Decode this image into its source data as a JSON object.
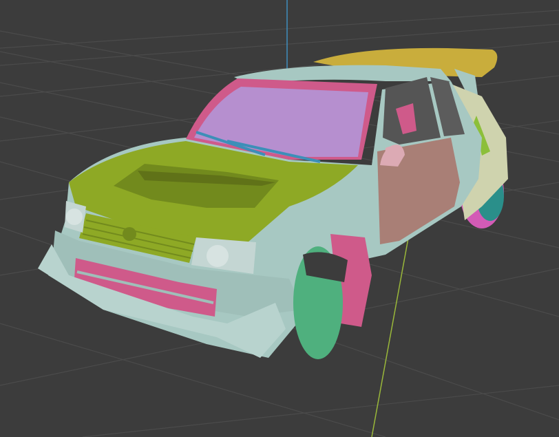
{
  "viewport": {
    "type": "3d-viewport",
    "object": "car-body-model",
    "colors": {
      "background": "#3c3c3c",
      "grid": "#4c4c4c",
      "axis_y": "#9ab83a",
      "axis_z": "#3f8fbf",
      "body": "#a7c8c2",
      "body_shadow": "#86a9a4",
      "hood": "#8ea925",
      "windshield": "#b68fcf",
      "door": "#a97f76",
      "spoiler": "#c9ad3c",
      "pink_parts": "#cf5a8a",
      "wheel_front": "#4fb07e",
      "wheel_rear_tire": "#d35bb6",
      "wheel_rear_rim": "#2a8f8a",
      "wiper": "#3c8fb8",
      "rear_panel": "#cfd3ae",
      "rear_green": "#8cbf3a"
    }
  }
}
